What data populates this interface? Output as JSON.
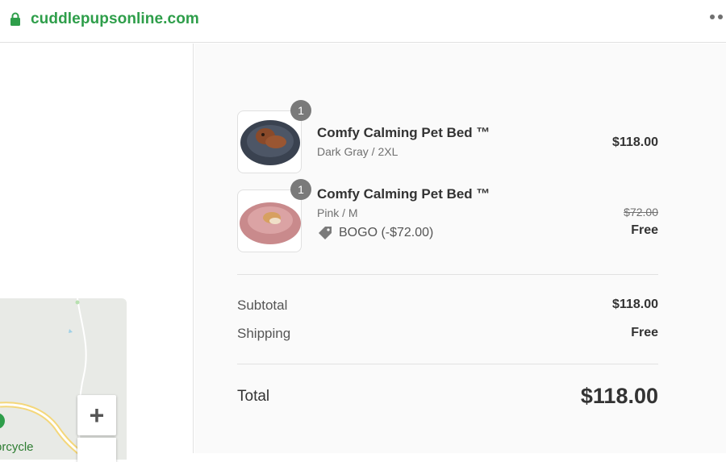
{
  "browser": {
    "url": "cuddlepupsonline.com"
  },
  "map": {
    "label": "orcycle",
    "zoom_in_label": "+"
  },
  "cart": {
    "items": [
      {
        "quantity": "1",
        "name": "Comfy Calming Pet Bed ™",
        "variant": "Dark Gray / 2XL",
        "price": "$118.00"
      },
      {
        "quantity": "1",
        "name": "Comfy Calming Pet Bed ™",
        "variant": "Pink / M",
        "original_price": "$72.00",
        "price": "Free",
        "discount": "BOGO (-$72.00)"
      }
    ],
    "subtotal_label": "Subtotal",
    "subtotal_value": "$118.00",
    "shipping_label": "Shipping",
    "shipping_value": "Free",
    "total_label": "Total",
    "total_value": "$118.00"
  },
  "colors": {
    "brand_green": "#2e9e4a",
    "badge_gray": "#7a7a7a"
  }
}
